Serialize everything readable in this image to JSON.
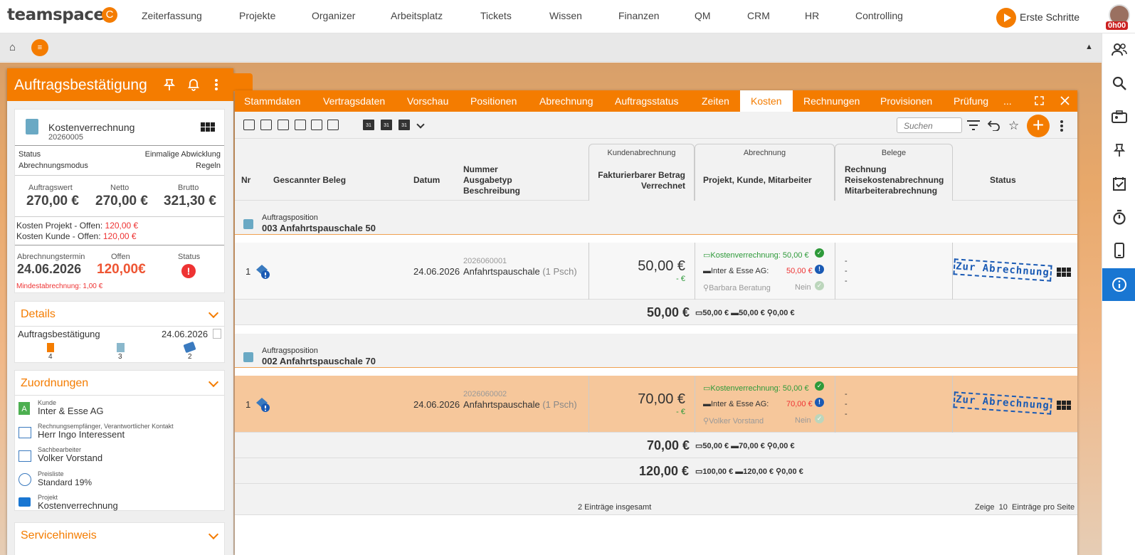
{
  "app": {
    "logo": "teamspace",
    "logo_mark": "C",
    "timer": "0h00",
    "first_steps": "Erste Schritte"
  },
  "topnav": [
    "Zeiterfassung",
    "Projekte",
    "Organizer",
    "Arbeitsplatz",
    "Tickets",
    "Wissen",
    "Finanzen",
    "QM",
    "CRM",
    "HR",
    "Controlling"
  ],
  "sidebar": {
    "title": "Auftragsbestätigung",
    "card": {
      "name": "Kostenverrechnung",
      "number": "20260005",
      "status_label": "Status",
      "status_value": "Einmalige Abwicklung",
      "mode_label": "Abrechnungsmodus",
      "mode_value": "Regeln",
      "auftragswert_label": "Auftragswert",
      "auftragswert": "270,00 €",
      "netto_label": "Netto",
      "netto": "270,00 €",
      "brutto_label": "Brutto",
      "brutto": "321,30 €",
      "kosten_projekt_label": "Kosten Projekt - Offen:",
      "kosten_projekt": "120,00 €",
      "kosten_kunde_label": "Kosten Kunde - Offen:",
      "kosten_kunde": "120,00 €",
      "termin_label": "Abrechnungstermin",
      "termin": "24.06.2026",
      "offen_label": "Offen",
      "offen": "120,00€",
      "status2_label": "Status",
      "mindest": "Mindestabrechnung: 1,00 €"
    },
    "details": {
      "title": "Details",
      "doc": "Auftragsbestätigung",
      "date": "24.06.2026",
      "count1": "4",
      "count2": "3",
      "count3": "2"
    },
    "zuordnungen": {
      "title": "Zuordnungen",
      "items": [
        {
          "label": "Kunde",
          "value": "Inter & Esse AG"
        },
        {
          "label": "Rechnungsempfänger, Verantwortlicher Kontakt",
          "value": "Herr Ingo Interessent"
        },
        {
          "label": "Sachbearbeiter",
          "value": "Volker Vorstand"
        },
        {
          "label": "Preisliste",
          "value": "Standard 19%"
        },
        {
          "label": "Projekt",
          "value": "Kostenverrechnung"
        }
      ]
    },
    "servicehinweis": {
      "title": "Servicehinweis"
    }
  },
  "tabs": [
    "Stammdaten",
    "Vertragsdaten",
    "Vorschau",
    "Positionen",
    "Abrechnung",
    "Auftragsstatus",
    "Zeiten",
    "Kosten",
    "Rechnungen",
    "Provisionen",
    "Prüfung",
    "..."
  ],
  "active_tab": "Kosten",
  "toolbar": {
    "search_placeholder": "Suchen",
    "cal_label": "31"
  },
  "table": {
    "headers": {
      "nr": "Nr",
      "beleg": "Gescannter Beleg",
      "datum": "Datum",
      "nummer": "Nummer",
      "ausgabetyp": "Ausgabetyp",
      "beschreibung": "Beschreibung",
      "kunden_group": "Kundenabrechnung",
      "fakt": "Fakturierbarer Betrag",
      "verrechnet": "Verrechnet",
      "abr_group": "Abrechnung",
      "pkm": "Projekt, Kunde, Mitarbeiter",
      "belege_group": "Belege",
      "rechnung": "Rechnung",
      "reise": "Reisekostenabrechnung",
      "mitarbeiter": "Mitarbeiterabrechnung",
      "status": "Status"
    },
    "positions": [
      {
        "label": "Auftragsposition",
        "title": "003 Anfahrtspauschale 50",
        "row": {
          "nr": "1",
          "datum": "24.06.2026",
          "nummer": "2026060001",
          "typ": "Anfahrtspauschale",
          "unit": "(1 Psch)",
          "betrag": "50,00 €",
          "verrechnet": "- €",
          "kv": "Kostenverrechnung: 50,00 €",
          "kunde": "Inter & Esse AG:",
          "kunde_betrag": "50,00 €",
          "mitarbeiter": "Barbara Beratung",
          "nein": "Nein",
          "dash1": "-",
          "dash2": "-",
          "dash3": "-",
          "stamp": "Zur Abrechnung"
        },
        "sum": {
          "total": "50,00 €",
          "s1": "50,00 €",
          "s2": "50,00 €",
          "s3": "0,00 €"
        }
      },
      {
        "label": "Auftragsposition",
        "title": "002 Anfahrtspauschale 70",
        "row": {
          "nr": "1",
          "datum": "24.06.2026",
          "nummer": "2026060002",
          "typ": "Anfahrtspauschale",
          "unit": "(1 Psch)",
          "betrag": "70,00 €",
          "verrechnet": "- €",
          "kv": "Kostenverrechnung: 50,00 €",
          "kunde": "Inter & Esse AG:",
          "kunde_betrag": "70,00 €",
          "mitarbeiter": "Volker Vorstand",
          "nein": "Nein",
          "dash1": "-",
          "dash2": "-",
          "dash3": "-",
          "stamp": "Zur Abrechnung"
        },
        "sum": {
          "total": "70,00 €",
          "s1": "50,00 €",
          "s2": "70,00 €",
          "s3": "0,00 €"
        }
      }
    ],
    "grand_total": {
      "total": "120,00 €",
      "s1": "100,00 €",
      "s2": "120,00 €",
      "s3": "0,00 €"
    },
    "footer": {
      "count": "2 Einträge insgesamt",
      "zeige": "Zeige",
      "per_page": "10",
      "suffix": "Einträge pro Seite"
    }
  },
  "colors": {
    "accent": "#f47c00",
    "highlight_row": "#f6c79b",
    "info": "#1976d2"
  }
}
